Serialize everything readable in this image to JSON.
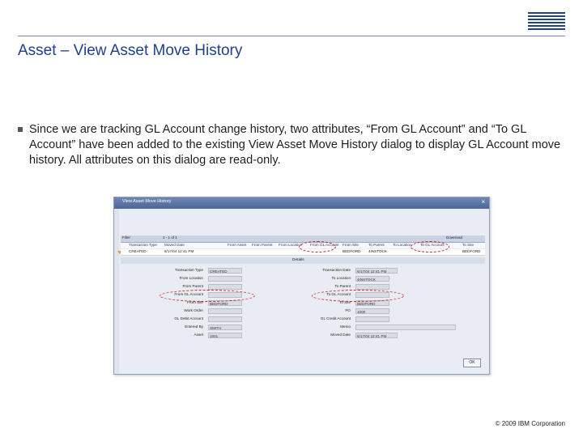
{
  "header": {
    "logo_text": "IBM",
    "title": "Asset – View Asset Move History"
  },
  "bullet": {
    "text": "Since we are tracking GL Account change history, two attributes, “From GL Account” and “To GL Account” have been added to the existing View Asset Move History dialog to display GL Account move history. All attributes on this dialog are read-only."
  },
  "dialog": {
    "title": "View Asset Move History",
    "close_glyph": "×",
    "toolbar": {
      "filter": "Filter",
      "pager": "1 - 1 of 1",
      "download": "Download"
    },
    "columns": [
      "Transaction Type",
      "Moved Date",
      "From Asset",
      "From Parent",
      "From Location",
      "From GL Account",
      "From Site",
      "To Parent",
      "To Location",
      "To GL Account",
      "To Site"
    ],
    "row": {
      "transaction_type": "CREATED",
      "moved_date": "6/17/04 12:41 PM",
      "from_site": "BEDFORD",
      "to_location": "4INSTOCK",
      "to_site": "BEDFORD"
    },
    "details_label": "Details",
    "left_fields": [
      {
        "label": "Transaction Type",
        "value": "CREATED"
      },
      {
        "label": "From Location",
        "value": ""
      },
      {
        "label": "From Parent",
        "value": ""
      },
      {
        "label": "From GL Account",
        "value": ""
      },
      {
        "label": "From Site",
        "value": "BEDFORD"
      },
      {
        "label": "Work Order",
        "value": ""
      },
      {
        "label": "GL Debit Account",
        "value": ""
      },
      {
        "label": "Entered By",
        "value": "SMITH"
      },
      {
        "label": "Asset",
        "value": "1001"
      }
    ],
    "right_fields": [
      {
        "label": "Transaction Date",
        "value": "6/17/04 12:41 PM"
      },
      {
        "label": "To Location",
        "value": "4INSTOCK"
      },
      {
        "label": "To Parent",
        "value": ""
      },
      {
        "label": "To GL Account",
        "value": ""
      },
      {
        "label": "To Site",
        "value": "BEDFORD"
      },
      {
        "label": "PO",
        "value": "1000"
      },
      {
        "label": "GL Credit Account",
        "value": ""
      },
      {
        "label": "Memo",
        "value": ""
      },
      {
        "label": "Moved Date",
        "value": "6/17/04 12:41 PM"
      }
    ],
    "ok_label": "OK"
  },
  "footer": {
    "copyright": "© 2009 IBM Corporation"
  },
  "colors": {
    "title": "#1f3f8f",
    "highlight_oval": "#d02020",
    "dialog_titlebar": "#4b6698"
  }
}
